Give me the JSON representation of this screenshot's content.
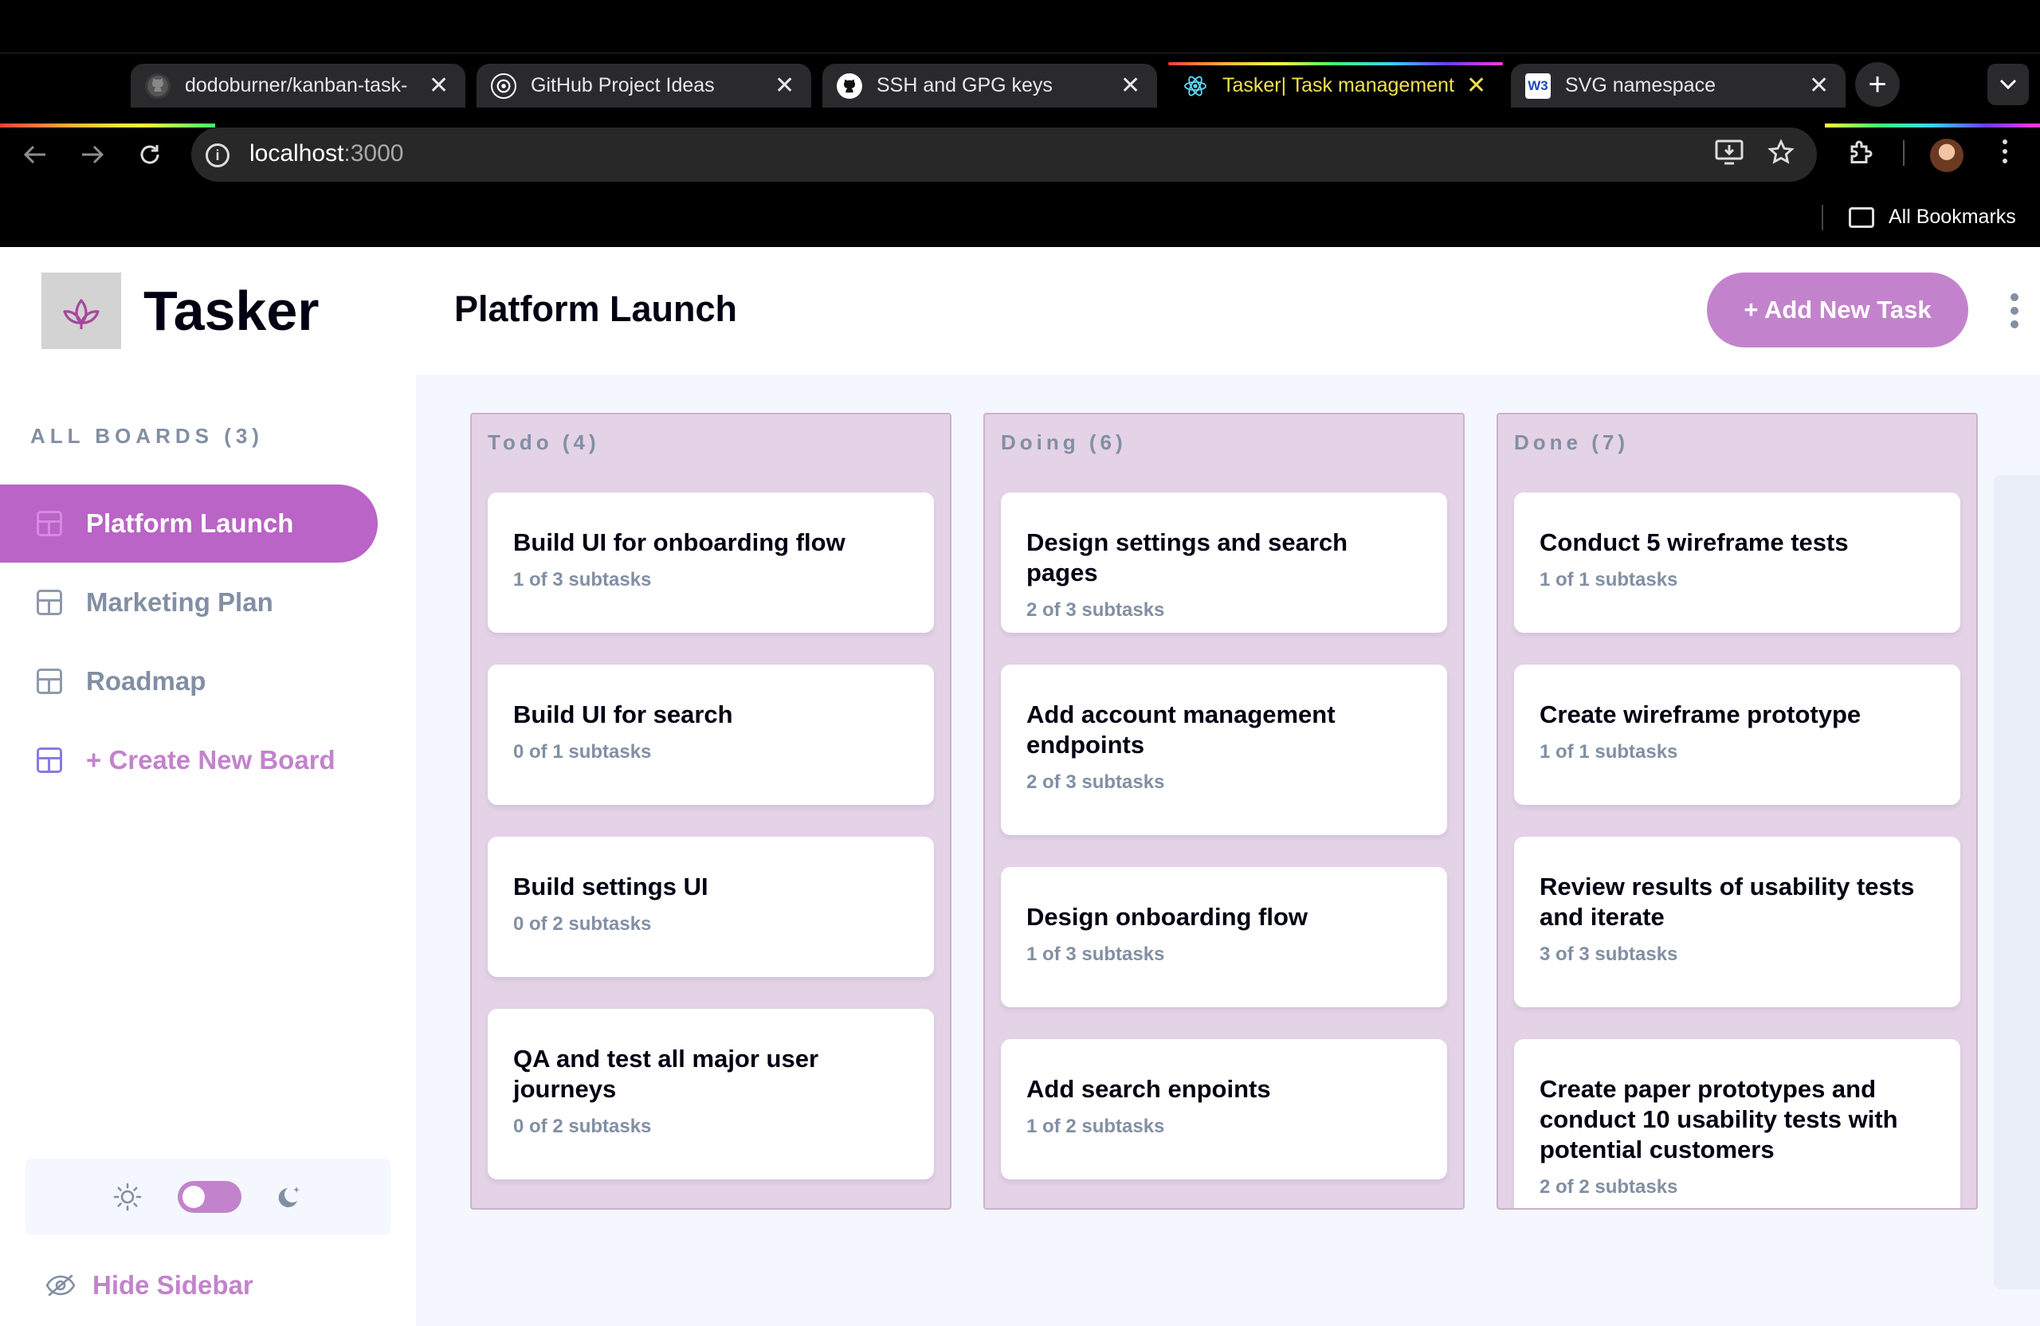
{
  "browser": {
    "tabs": [
      {
        "title": "dodoburner/kanban-task-",
        "favicon": "github-icon"
      },
      {
        "title": "GitHub Project Ideas",
        "favicon": "chatgpt-icon"
      },
      {
        "title": "SSH and GPG keys",
        "favicon": "github-icon"
      },
      {
        "title": "Tasker| Task management",
        "favicon": "react-icon"
      },
      {
        "title": "SVG namespace",
        "favicon": "w3schools-icon"
      }
    ],
    "new_tab": "+",
    "url_host": "localhost",
    "url_port": ":3000",
    "bookmarks_label": "All Bookmarks"
  },
  "sidebar": {
    "brand": "Tasker",
    "boards_heading": "ALL BOARDS (3)",
    "boards": [
      {
        "label": "Platform Launch"
      },
      {
        "label": "Marketing Plan"
      },
      {
        "label": "Roadmap"
      }
    ],
    "create_board": "+ Create New Board",
    "hide_sidebar": "Hide Sidebar"
  },
  "header": {
    "board_title": "Platform Launch",
    "add_task": "+ Add New Task"
  },
  "columns": [
    {
      "heading": "Todo (4)",
      "cards": [
        {
          "title": "Build UI for onboarding flow",
          "subtasks": "1 of 3 subtasks"
        },
        {
          "title": "Build UI for search",
          "subtasks": "0 of 1 subtasks"
        },
        {
          "title": "Build settings UI",
          "subtasks": "0 of 2 subtasks"
        },
        {
          "title": "QA and test all major user journeys",
          "subtasks": "0 of 2 subtasks"
        }
      ]
    },
    {
      "heading": "Doing (6)",
      "cards": [
        {
          "title": "Design settings and search pages",
          "subtasks": "2 of 3 subtasks"
        },
        {
          "title": "Add account management endpoints",
          "subtasks": "2 of 3 subtasks"
        },
        {
          "title": "Design onboarding flow",
          "subtasks": "1 of 3 subtasks"
        },
        {
          "title": "Add search enpoints",
          "subtasks": "1 of 2 subtasks"
        }
      ]
    },
    {
      "heading": "Done (7)",
      "cards": [
        {
          "title": "Conduct 5 wireframe tests",
          "subtasks": "1 of 1 subtasks"
        },
        {
          "title": "Create wireframe prototype",
          "subtasks": "1 of 1 subtasks"
        },
        {
          "title": "Review results of usability tests and iterate",
          "subtasks": "3 of 3 subtasks"
        },
        {
          "title": "Create paper prototypes and conduct 10 usability tests with potential customers",
          "subtasks": "2 of 2 subtasks"
        }
      ]
    }
  ],
  "colors": {
    "accent": "#b964c6",
    "accent_light": "#c283cc",
    "column_bg": "#e4d2e6"
  }
}
